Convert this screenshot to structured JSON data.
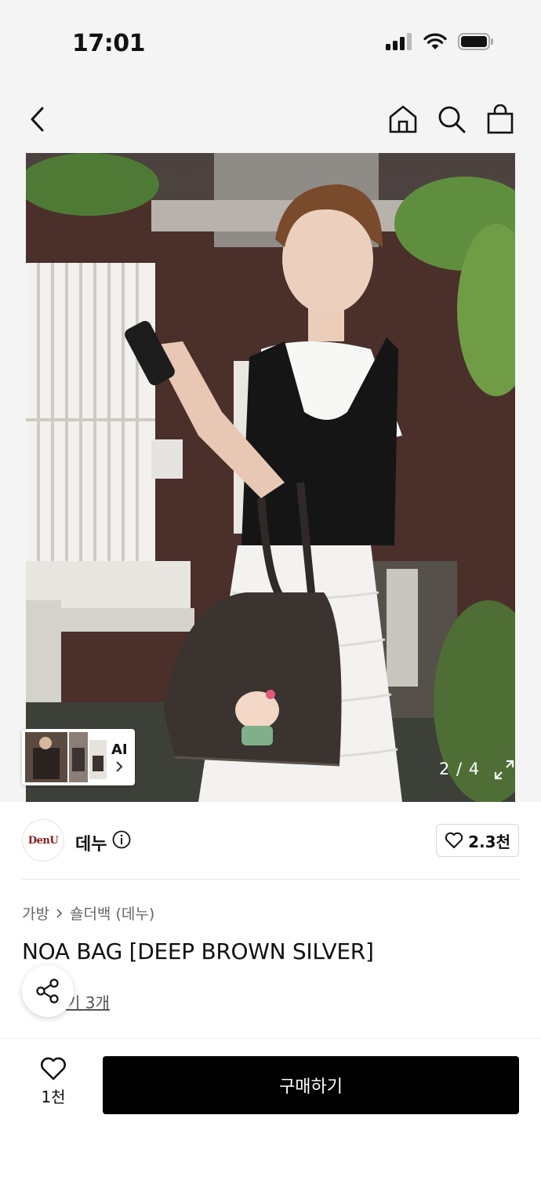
{
  "status_bar": {
    "time": "17:01"
  },
  "icons": {
    "back": "back-arrow-icon",
    "home": "home-icon",
    "search": "search-icon",
    "bag": "shopping-bag-icon",
    "info": "info-icon",
    "heart": "heart-icon",
    "share": "share-icon",
    "expand": "expand-icon"
  },
  "gallery": {
    "counter": "2 / 4",
    "ai_label": "AI"
  },
  "brand": {
    "logo_text": "DenU",
    "name": "데누",
    "likes": "2.3천"
  },
  "product": {
    "breadcrumb": [
      "가방",
      "숄더백 (데누)"
    ],
    "title": "NOA BAG [DEEP BROWN SILVER]",
    "reviews_label": "후기 3개",
    "reviews_visible": "기 3개"
  },
  "bottom_bar": {
    "wish_count": "1천",
    "buy_label": "구매하기"
  },
  "colors": {
    "background": "#f4f4f4",
    "buy_button": "#000000",
    "brand_logo_text": "#8a1a1a"
  }
}
